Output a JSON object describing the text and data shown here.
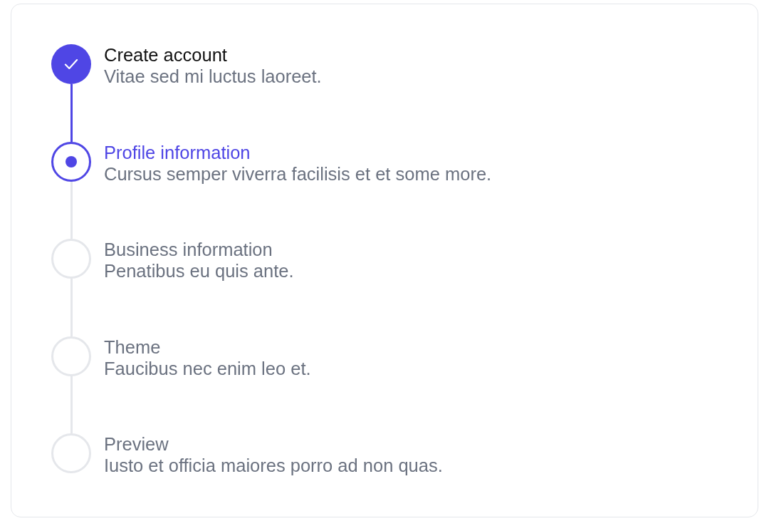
{
  "steps": [
    {
      "title": "Create account",
      "description": "Vitae sed mi luctus laoreet.",
      "kind": "complete"
    },
    {
      "title": "Profile information",
      "description": "Cursus semper viverra facilisis et et some more.",
      "kind": "current"
    },
    {
      "title": "Business information",
      "description": "Penatibus eu quis ante.",
      "kind": "upcoming"
    },
    {
      "title": "Theme",
      "description": "Faucibus nec enim leo et.",
      "kind": "upcoming"
    },
    {
      "title": "Preview",
      "description": "Iusto et officia maiores porro ad non quas.",
      "kind": "upcoming"
    }
  ]
}
